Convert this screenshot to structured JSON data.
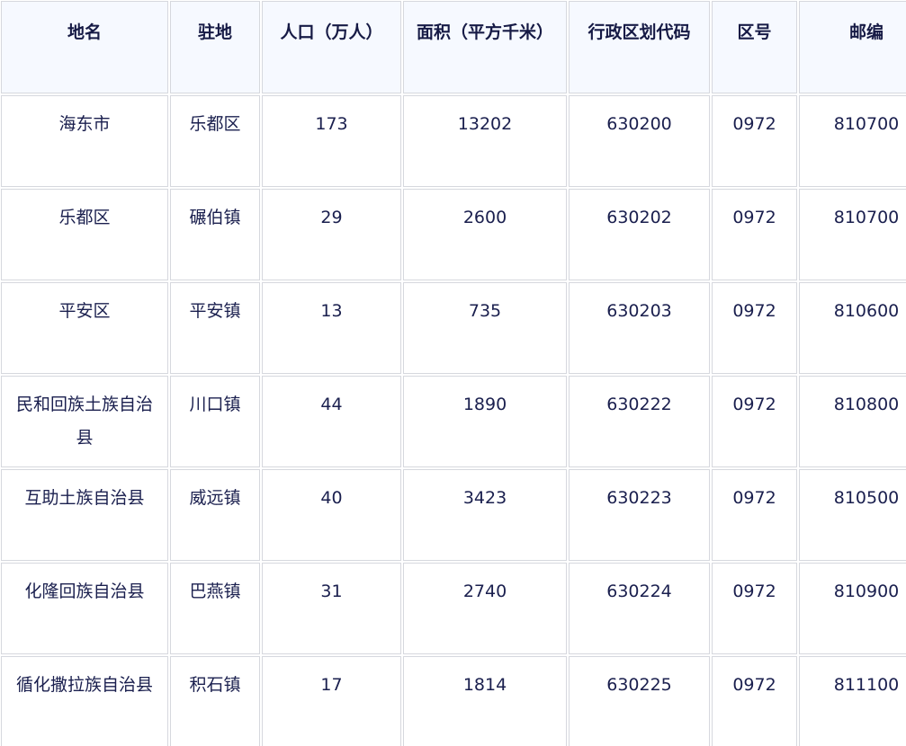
{
  "table": {
    "headers": [
      "地名",
      "驻地",
      "人口（万人）",
      "面积（平方千米）",
      "行政区划代码",
      "区号",
      "邮编"
    ],
    "rows": [
      [
        "海东市",
        "乐都区",
        "173",
        "13202",
        "630200",
        "0972",
        "810700"
      ],
      [
        "乐都区",
        "碾伯镇",
        "29",
        "2600",
        "630202",
        "0972",
        "810700"
      ],
      [
        "平安区",
        "平安镇",
        "13",
        "735",
        "630203",
        "0972",
        "810600"
      ],
      [
        "民和回族土族自治县",
        "川口镇",
        "44",
        "1890",
        "630222",
        "0972",
        "810800"
      ],
      [
        "互助土族自治县",
        "威远镇",
        "40",
        "3423",
        "630223",
        "0972",
        "810500"
      ],
      [
        "化隆回族自治县",
        "巴燕镇",
        "31",
        "2740",
        "630224",
        "0972",
        "810900"
      ],
      [
        "循化撒拉族自治县",
        "积石镇",
        "17",
        "1814",
        "630225",
        "0972",
        "811100"
      ]
    ]
  },
  "colors": {
    "header_bg": "#f6f9ff",
    "border": "#d6d8de",
    "text": "#1a1f4e"
  }
}
